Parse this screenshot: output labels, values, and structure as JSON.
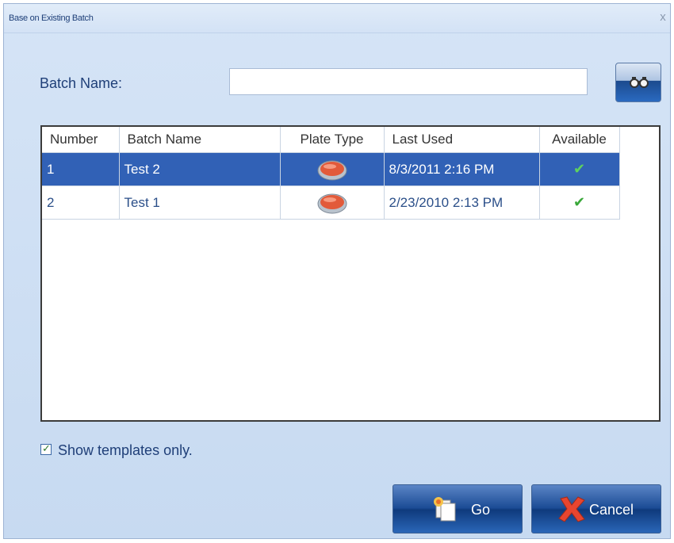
{
  "window": {
    "title": "Base on Existing Batch",
    "close_glyph": "x"
  },
  "form": {
    "batch_name_label": "Batch Name:",
    "batch_name_value": "",
    "search_icon": "binoculars-icon"
  },
  "grid": {
    "columns": [
      "Number",
      "Batch Name",
      "Plate Type",
      "Last Used",
      "Available"
    ],
    "rows": [
      {
        "number": "1",
        "batch_name": "Test 2",
        "plate_type_icon": "red-plate-icon",
        "last_used": "8/3/2011 2:16 PM",
        "available": "✔",
        "selected": true
      },
      {
        "number": "2",
        "batch_name": "Test 1",
        "plate_type_icon": "red-plate-icon",
        "last_used": "2/23/2010 2:13 PM",
        "available": "✔",
        "selected": false
      }
    ]
  },
  "options": {
    "show_templates_label": "Show templates only.",
    "show_templates_checked": true
  },
  "buttons": {
    "go_label": "Go",
    "cancel_label": "Cancel"
  },
  "colors": {
    "selection": "#3161b6",
    "accent_blue": "#1b4b95",
    "check_green": "#3aa83a"
  }
}
